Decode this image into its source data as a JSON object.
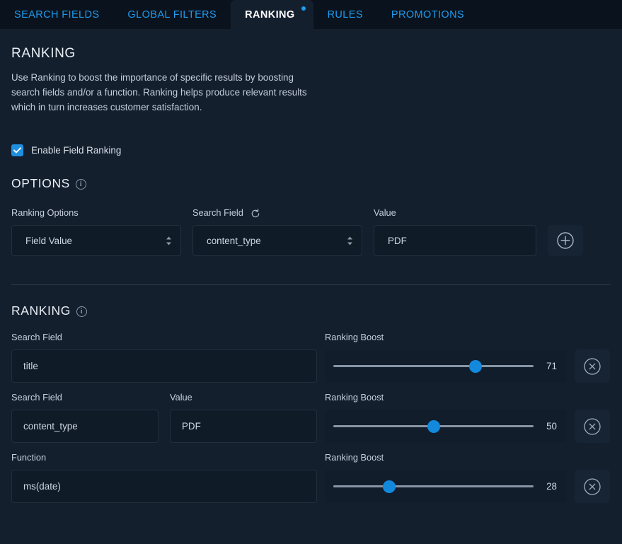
{
  "tabs": [
    {
      "label": "SEARCH FIELDS",
      "active": false,
      "badge": false
    },
    {
      "label": "GLOBAL FILTERS",
      "active": false,
      "badge": false
    },
    {
      "label": "RANKING",
      "active": true,
      "badge": true
    },
    {
      "label": "RULES",
      "active": false,
      "badge": false
    },
    {
      "label": "PROMOTIONS",
      "active": false,
      "badge": false
    }
  ],
  "page": {
    "title": "RANKING",
    "description": "Use Ranking to boost the importance of specific results by boosting search fields and/or a function. Ranking helps produce relevant results which in turn increases customer satisfaction.",
    "enable_checkbox_label": "Enable Field Ranking",
    "enable_checked": true
  },
  "options": {
    "heading": "OPTIONS",
    "info_icon": "info-icon",
    "ranking_options_label": "Ranking Options",
    "ranking_options_value": "Field Value",
    "search_field_label": "Search Field",
    "search_field_refresh_icon": "refresh-icon",
    "search_field_value": "content_type",
    "value_label": "Value",
    "value_value": "PDF",
    "add_button_icon": "plus-circle-icon"
  },
  "ranking": {
    "heading": "RANKING",
    "info_icon": "info-icon",
    "labels": {
      "search_field": "Search Field",
      "value": "Value",
      "function": "Function",
      "ranking_boost": "Ranking Boost"
    },
    "remove_icon": "close-circle-icon",
    "rows": [
      {
        "type": "field",
        "field_label": "Search Field",
        "field_value": "title",
        "has_value": false,
        "boost_label": "Ranking Boost",
        "boost": 71
      },
      {
        "type": "field_value",
        "field_label": "Search Field",
        "field_value": "content_type",
        "has_value": true,
        "value_label": "Value",
        "value_value": "PDF",
        "boost_label": "Ranking Boost",
        "boost": 50
      },
      {
        "type": "function",
        "field_label": "Function",
        "field_value": "ms(date)",
        "has_value": false,
        "boost_label": "Ranking Boost",
        "boost": 28
      }
    ]
  },
  "colors": {
    "accent": "#1f9bf0",
    "slider": "#1389dd",
    "background": "#141f2e",
    "tabbar": "#0a131d",
    "field": "#101b28"
  }
}
